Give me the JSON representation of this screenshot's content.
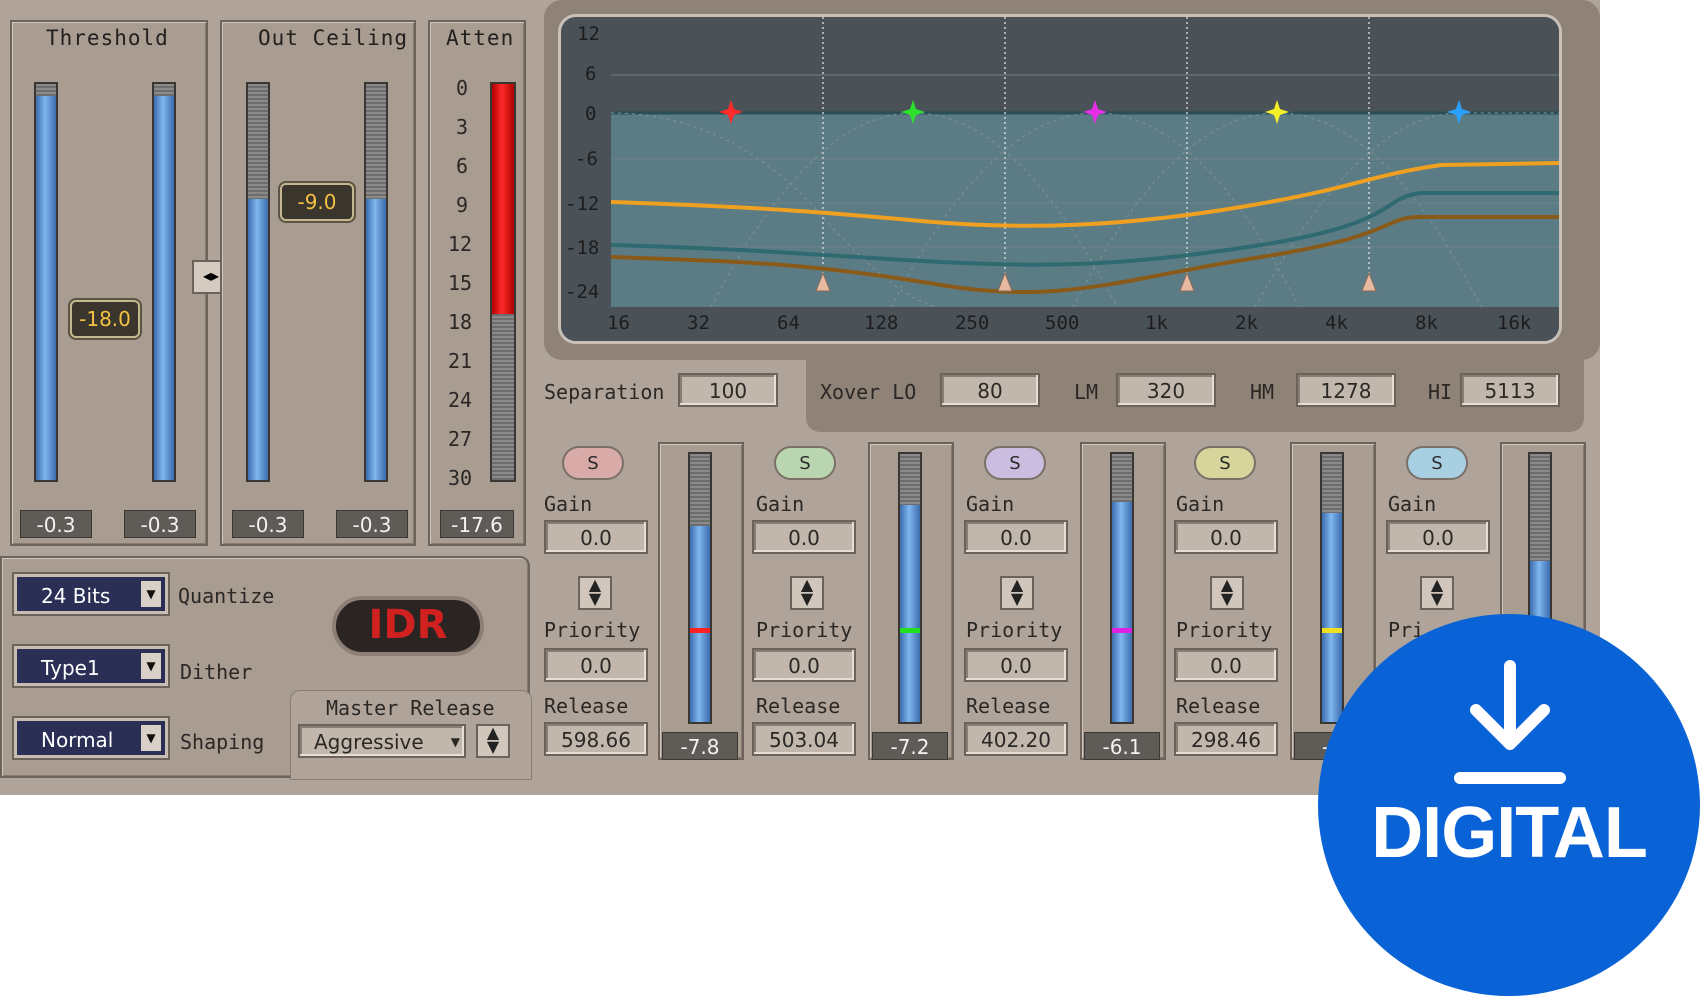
{
  "threshold": {
    "label": "Threshold",
    "handle_value": "-18.0",
    "readout_left": "-0.3",
    "readout_right": "-0.3",
    "level_fraction": 0.97
  },
  "out_ceiling": {
    "label": "Out Ceiling",
    "handle_value": "-9.0",
    "readout_left": "-0.3",
    "readout_right": "-0.3",
    "level_fraction": 0.71
  },
  "atten": {
    "label": "Atten",
    "scale": [
      "0",
      "3",
      "6",
      "9",
      "12",
      "15",
      "18",
      "21",
      "24",
      "27",
      "30"
    ],
    "readout": "-17.6",
    "level_fraction": 0.58
  },
  "link_icon": "link-arrows-icon",
  "graph": {
    "y_ticks": [
      "12",
      "6",
      "0",
      "-6",
      "-12",
      "-18",
      "-24"
    ],
    "x_ticks": [
      "16",
      "32",
      "64",
      "128",
      "250",
      "500",
      "1k",
      "2k",
      "4k",
      "8k",
      "16k"
    ],
    "band_colors": [
      "#ff2a2a",
      "#2ee02e",
      "#e52ee5",
      "#f5ef2a",
      "#2aa0ff"
    ]
  },
  "separation": {
    "label": "Separation",
    "value": "100"
  },
  "xover": {
    "lo_label": "Xover LO",
    "lo_value": "80",
    "lm_label": "LM",
    "lm_value": "320",
    "hm_label": "HM",
    "hm_value": "1278",
    "hi_label": "HI",
    "hi_value": "5113"
  },
  "bands": [
    {
      "solo": "S",
      "gain_label": "Gain",
      "gain": "0.0",
      "priority_label": "Priority",
      "priority": "0.0",
      "release_label": "Release",
      "release": "598.66",
      "meter": "-7.8",
      "color": "#ff2020",
      "solo_color": "#d8aaa8",
      "level_fraction": 0.73
    },
    {
      "solo": "S",
      "gain_label": "Gain",
      "gain": "0.0",
      "priority_label": "Priority",
      "priority": "0.0",
      "release_label": "Release",
      "release": "503.04",
      "meter": "-7.2",
      "color": "#20e020",
      "solo_color": "#b9d6b0",
      "level_fraction": 0.81
    },
    {
      "solo": "S",
      "gain_label": "Gain",
      "gain": "0.0",
      "priority_label": "Priority",
      "priority": "0.0",
      "release_label": "Release",
      "release": "402.20",
      "meter": "-6.1",
      "color": "#e020e0",
      "solo_color": "#cbbde0",
      "level_fraction": 0.82
    },
    {
      "solo": "S",
      "gain_label": "Gain",
      "gain": "0.0",
      "priority_label": "Priority",
      "priority": "0.0",
      "release_label": "Release",
      "release": "298.46",
      "meter": "-9",
      "color": "#f0e020",
      "solo_color": "#d7d59b",
      "level_fraction": 0.78
    },
    {
      "solo": "S",
      "gain_label": "Gain",
      "gain": "0.0",
      "priority_label": "Pri",
      "priority": "",
      "release_label": "",
      "release": "",
      "meter": "",
      "color": "#20a0ff",
      "solo_color": "#a9cfe2",
      "level_fraction": 0.6
    }
  ],
  "quantize": {
    "value": "24 Bits",
    "label": "Quantize"
  },
  "dither": {
    "value": "Type1",
    "label": "Dither"
  },
  "shaping": {
    "value": "Normal",
    "label": "Shaping"
  },
  "idr_logo": "IDR",
  "master_release": {
    "label": "Master Release",
    "value": "Aggressive"
  },
  "badge": {
    "text": "DIGITAL",
    "icon": "download-icon",
    "color": "#0a63d6"
  }
}
